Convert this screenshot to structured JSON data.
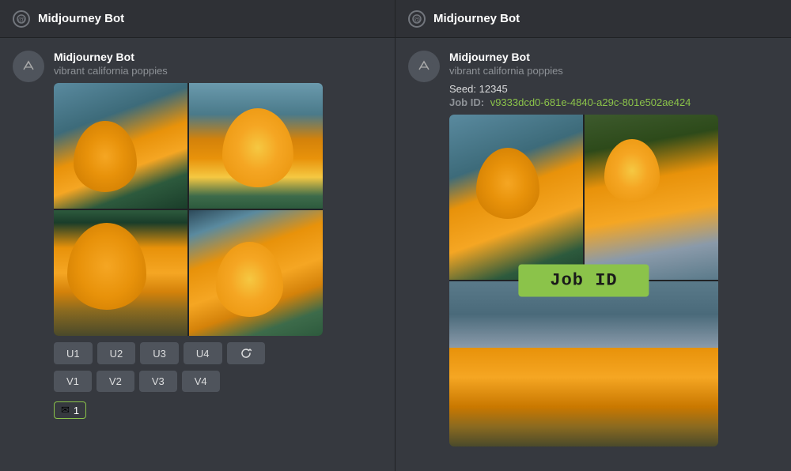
{
  "left_header": {
    "icon": "@",
    "title": "Midjourney Bot"
  },
  "right_header": {
    "icon": "@",
    "title": "Midjourney Bot"
  },
  "left_message": {
    "author": "Midjourney Bot",
    "subtitle": "vibrant california poppies"
  },
  "right_message": {
    "author": "Midjourney Bot",
    "subtitle": "vibrant california poppies",
    "seed_label": "Seed:",
    "seed_value": "12345",
    "jobid_label": "Job ID:",
    "jobid_value": "v9333dcd0-681e-4840-a29c-801e502ae424"
  },
  "job_id_overlay": "Job ID",
  "buttons": {
    "u1": "U1",
    "u2": "U2",
    "u3": "U3",
    "u4": "U4",
    "v1": "V1",
    "v2": "V2",
    "v3": "V3",
    "v4": "V4"
  },
  "reaction": {
    "count": "1"
  },
  "colors": {
    "accent": "#8bc34a",
    "bg_dark": "#2f3136",
    "bg_medium": "#36393f",
    "text_primary": "#ffffff",
    "text_muted": "#8e9297"
  }
}
